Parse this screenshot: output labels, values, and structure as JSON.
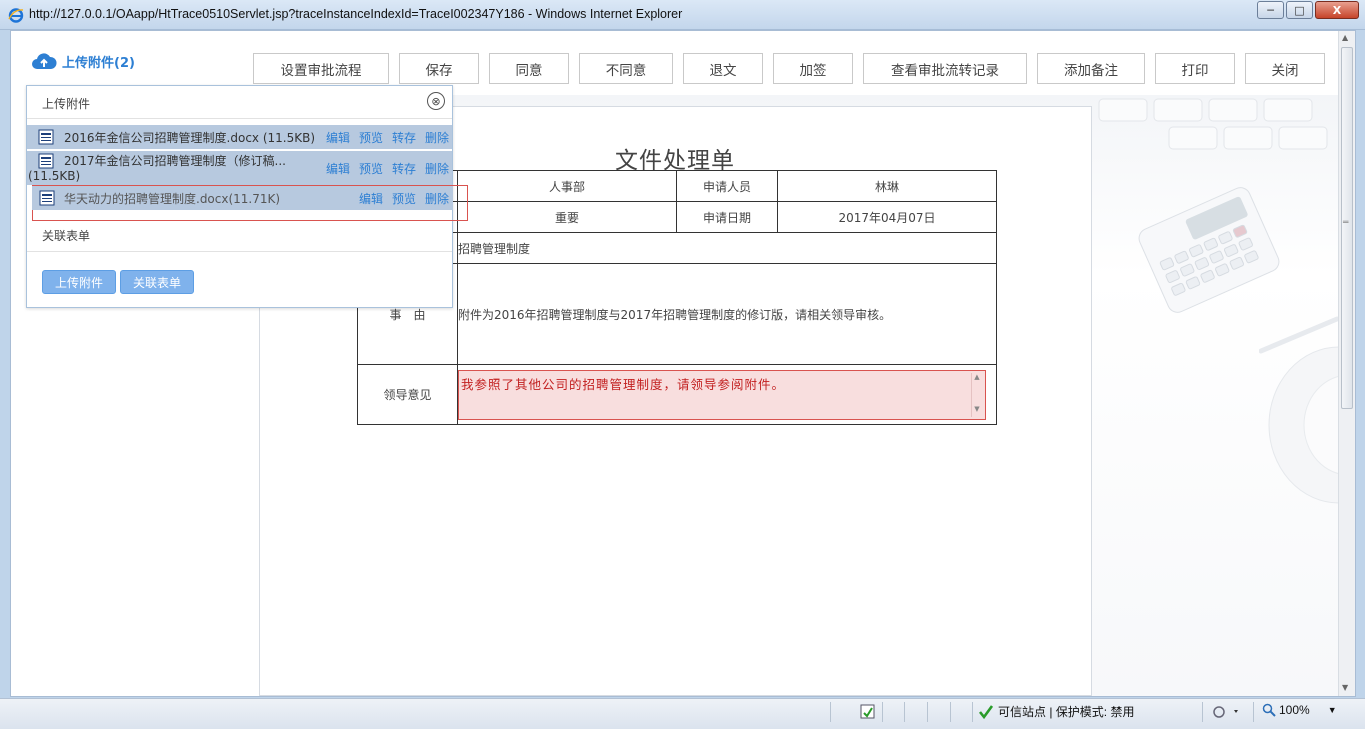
{
  "window": {
    "title": "http://127.0.0.1/OAapp/HtTrace0510Servlet.jsp?traceInstanceIndexId=TraceI002347Y186 - Windows Internet Explorer",
    "minimize": "─",
    "maximize": "□",
    "close": "X"
  },
  "upload_toggle": {
    "label": "上传附件(2)"
  },
  "toolbar": {
    "buttons": [
      "设置审批流程",
      "保存",
      "同意",
      "不同意",
      "退文",
      "加签",
      "查看审批流转记录",
      "添加备注",
      "打印",
      "关闭"
    ]
  },
  "popup": {
    "title": "上传附件",
    "close_icon": "⊗",
    "files": [
      {
        "name": "2016年金信公司招聘管理制度.docx (11.5KB)",
        "actions": [
          "编辑",
          "预览",
          "转存",
          "删除"
        ]
      },
      {
        "name": "2017年金信公司招聘管理制度（修订稿...",
        "name_cont": "(11.5KB)",
        "actions": [
          "编辑",
          "预览",
          "转存",
          "删除"
        ]
      },
      {
        "name": "华天动力的招聘管理制度.docx(11.71K)",
        "actions": [
          "编辑",
          "预览",
          "删除"
        ]
      }
    ],
    "related_label": "关联表单",
    "buttons": {
      "upload": "上传附件",
      "related": "关联表单"
    }
  },
  "form": {
    "title": "文件处理单",
    "department": "人事部",
    "applicant_label": "申请人员",
    "applicant": "林琳",
    "priority": "重要",
    "date_label": "申请日期",
    "date": "2017年04月07日",
    "subject": "招聘管理制度",
    "reason_label": "事　由",
    "reason": "附件为2016年招聘管理制度与2017年招聘管理制度的修订版，请相关领导审核。",
    "opinion_label": "领导意见",
    "opinion": "我参照了其他公司的招聘管理制度，请领导参阅附件。"
  },
  "statusbar": {
    "trusted": "可信站点 | 保护模式: 禁用",
    "zoom": "100%"
  }
}
